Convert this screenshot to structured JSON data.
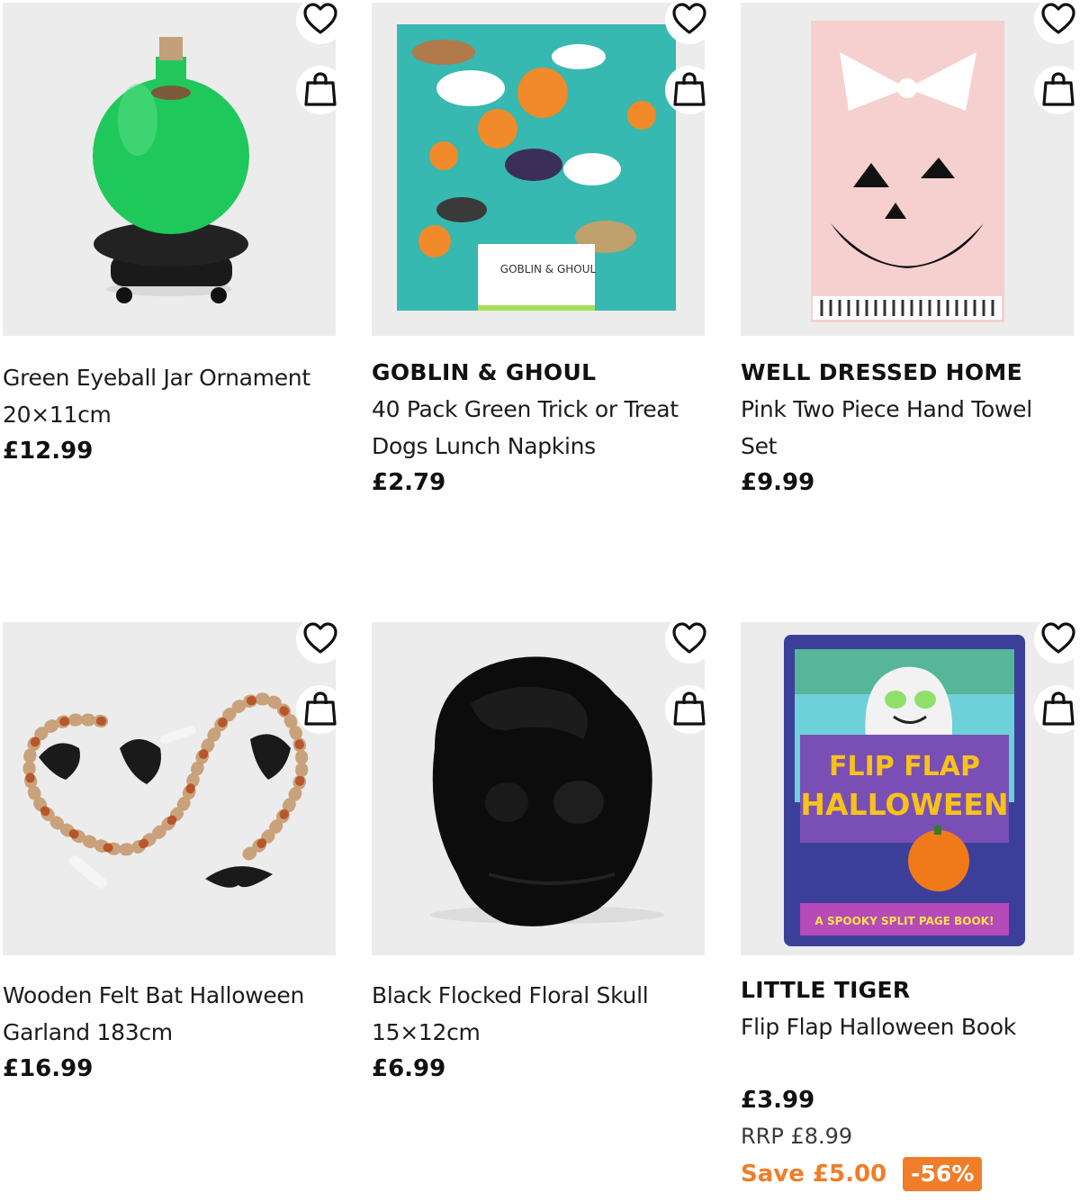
{
  "colors": {
    "accent": "#f07d2a",
    "text": "#111111",
    "image_bg": "#ececec"
  },
  "icons": {
    "wishlist": "heart-outline-icon",
    "basket": "shopping-bag-icon"
  },
  "products": [
    {
      "brand": "",
      "name_line1": "Green Eyeball Jar Ornament",
      "name_line2": "20×11cm",
      "price": "£12.99"
    },
    {
      "brand": "GOBLIN & GHOUL",
      "name_line1": "40 Pack Green Trick or Treat",
      "name_line2": "Dogs Lunch Napkins",
      "price": "£2.79",
      "packaging_text": "GOBLIN & GHOUL"
    },
    {
      "brand": "WELL DRESSED HOME",
      "name_line1": "Pink Two Piece Hand Towel",
      "name_line2": "Set",
      "price": "£9.99"
    },
    {
      "brand": "",
      "name_line1": "Wooden Felt Bat Halloween",
      "name_line2": "Garland 183cm",
      "price": "£16.99"
    },
    {
      "brand": "",
      "name_line1": "Black Flocked Floral Skull",
      "name_line2": "15×12cm",
      "price": "£6.99"
    },
    {
      "brand": "LITTLE TIGER",
      "name_line1": "Flip Flap Halloween Book",
      "name_line2": "",
      "price": "£3.99",
      "rrp": "RRP £8.99",
      "save": "Save £5.00",
      "discount": "-56%",
      "cover_title_1": "FLIP FLAP",
      "cover_title_2": "HALLOWEEN",
      "cover_tagline": "A SPOOKY SPLIT PAGE BOOK!"
    }
  ]
}
